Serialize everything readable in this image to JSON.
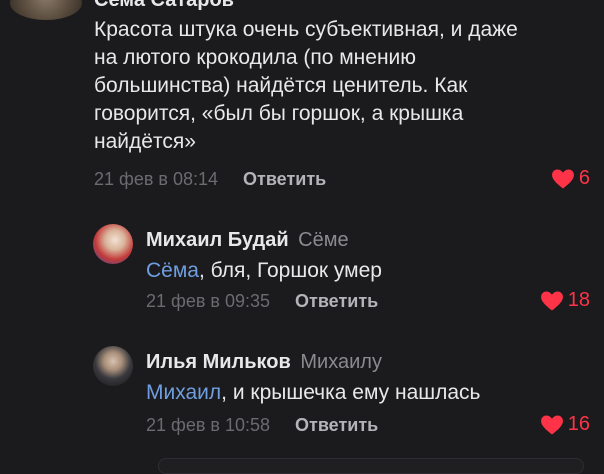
{
  "comments": [
    {
      "author": "Сема Сатаров",
      "reply_to": "",
      "mention": "",
      "text": "Красота штука очень субъективная, и даже на лютого крокодила (по мнению большинства) найдётся ценитель. Как говорится, «был бы горшок, а крышка найдётся»",
      "timestamp": "21 фев в 08:14",
      "reply_label": "Ответить",
      "likes": "6"
    },
    {
      "author": "Михаил Будай",
      "reply_to": "Сёме",
      "mention": "Сёма",
      "text": ", бля, Горшок умер",
      "timestamp": "21 фев в 09:35",
      "reply_label": "Ответить",
      "likes": "18"
    },
    {
      "author": "Илья Мильков",
      "reply_to": "Михаилу",
      "mention": "Михаил",
      "text": ", и крышечка ему нашлась",
      "timestamp": "21 фев в 10:58",
      "reply_label": "Ответить",
      "likes": "16"
    }
  ],
  "colors": {
    "background": "#1b1b1d",
    "like": "#ff3347",
    "mention": "#6f9ee0"
  },
  "icons": {
    "like": "heart-icon"
  }
}
